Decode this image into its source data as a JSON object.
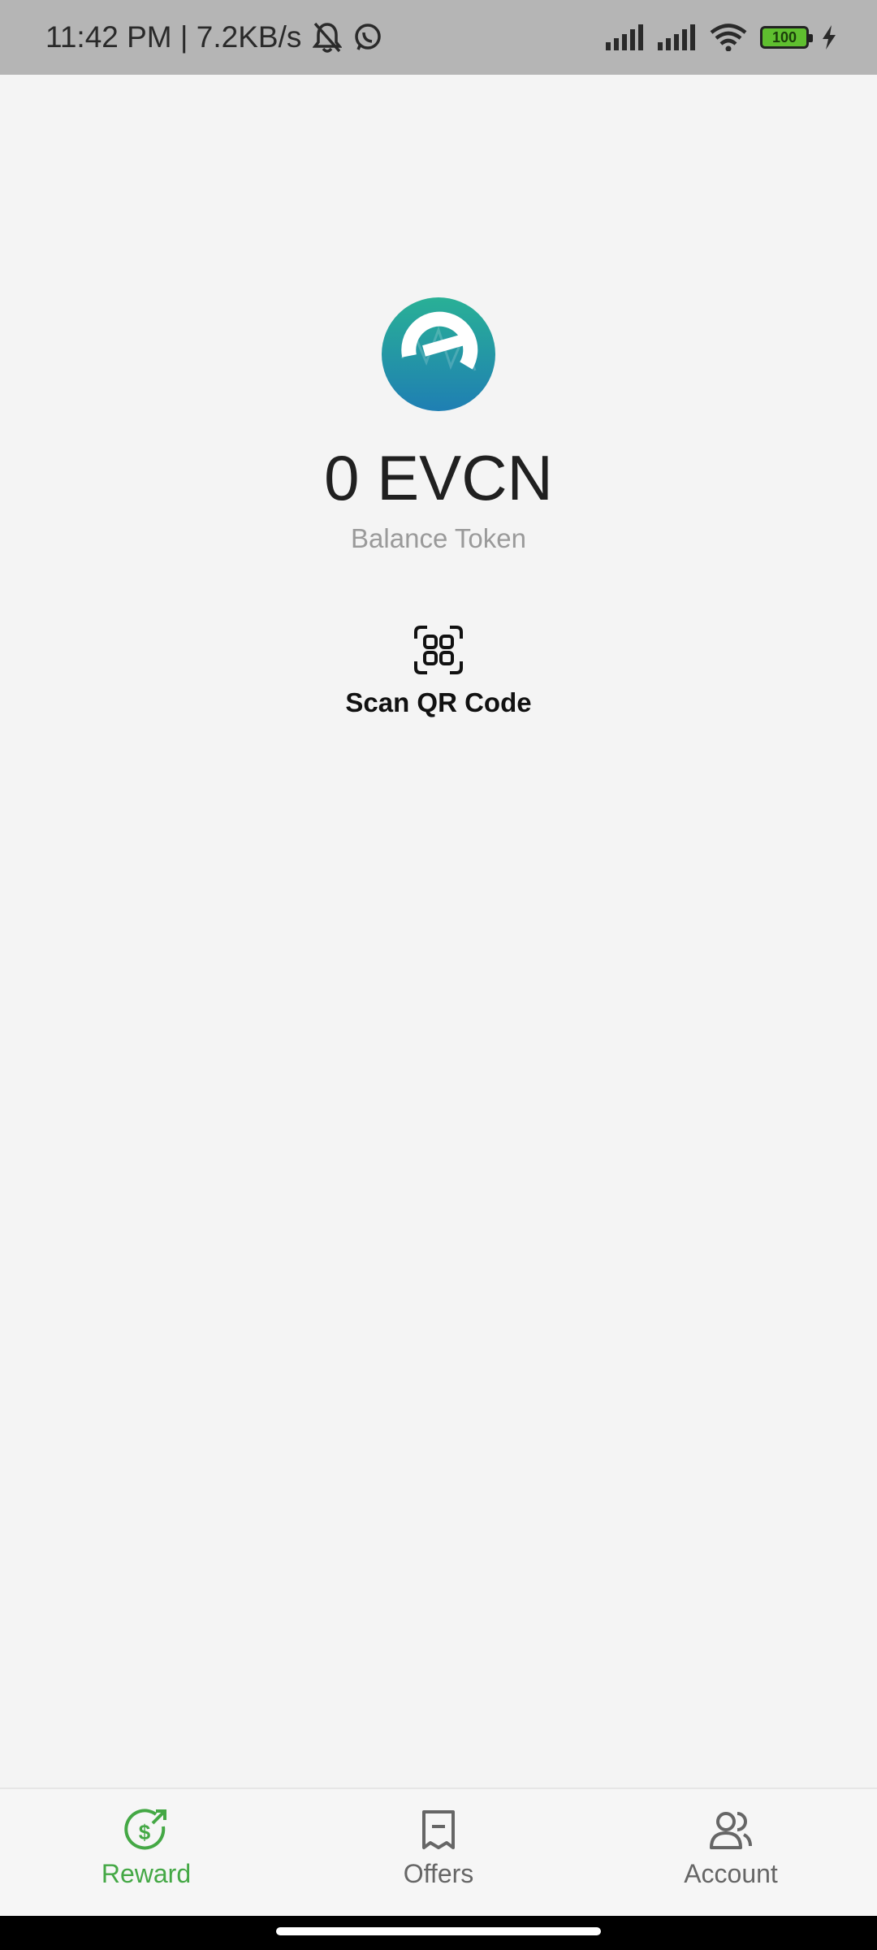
{
  "status_bar": {
    "time_speed": "11:42 PM | 7.2KB/s",
    "battery_level": "100",
    "battery_color": "#5fbf2f"
  },
  "main": {
    "balance": "0 EVCN",
    "balance_label": "Balance Token",
    "scan_label": "Scan QR Code"
  },
  "bottom_nav": {
    "items": [
      {
        "label": "Reward",
        "icon": "dollar-up-arrow-icon",
        "active": true
      },
      {
        "label": "Offers",
        "icon": "receipt-icon",
        "active": false
      },
      {
        "label": "Account",
        "icon": "users-icon",
        "active": false
      }
    ],
    "active_color": "#44a845"
  }
}
